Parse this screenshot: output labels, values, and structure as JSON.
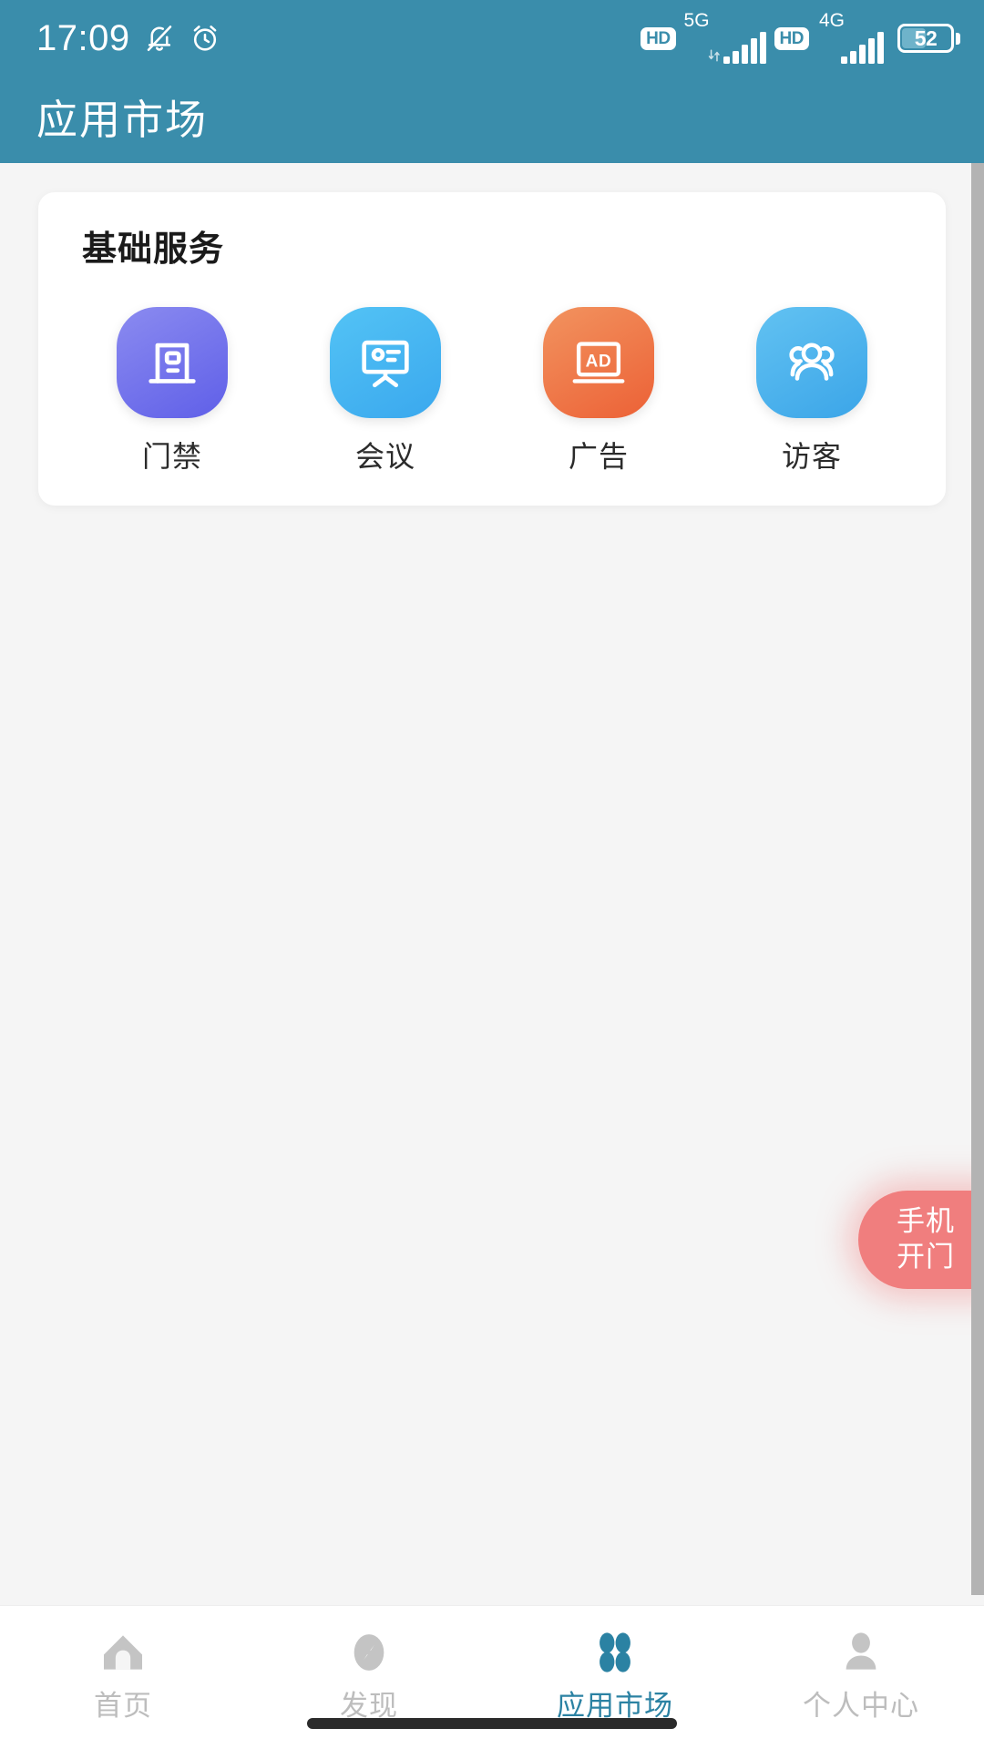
{
  "status_bar": {
    "time": "17:09",
    "mute_icon": "bell-muted-icon",
    "alarm_icon": "alarm-clock-icon",
    "sim1": {
      "hd_label": "HD",
      "network": "5G",
      "signal_bars": 5
    },
    "sim2": {
      "hd_label": "HD",
      "network": "4G",
      "signal_bars": 5
    },
    "battery": {
      "percent": "52",
      "level": 52
    }
  },
  "app_bar": {
    "title": "应用市场"
  },
  "card": {
    "title": "基础服务",
    "items": [
      {
        "label": "门禁",
        "icon": "door-access-icon",
        "color_start": "#8b8bf0",
        "color_end": "#5f5fe8"
      },
      {
        "label": "会议",
        "icon": "presentation-board-icon",
        "color_start": "#53c3f5",
        "color_end": "#3aa8ee"
      },
      {
        "label": "广告",
        "icon": "ad-screen-icon",
        "color_start": "#f2935f",
        "color_end": "#ec6136"
      },
      {
        "label": "访客",
        "icon": "visitors-group-icon",
        "color_start": "#62c2f2",
        "color_end": "#3ba5e8"
      }
    ]
  },
  "floating_button": {
    "line1": "手机",
    "line2": "开门",
    "color": "#f07e7e"
  },
  "bottom_nav": {
    "active_color": "#2b82a3",
    "inactive_color": "#bdbdbd",
    "items": [
      {
        "label": "首页",
        "icon": "home-icon",
        "active": false
      },
      {
        "label": "发现",
        "icon": "compass-icon",
        "active": false
      },
      {
        "label": "应用市场",
        "icon": "apps-grid-icon",
        "active": true
      },
      {
        "label": "个人中心",
        "icon": "person-icon",
        "active": false
      }
    ]
  },
  "theme": {
    "header_color": "#3a8dab",
    "background": "#f5f5f5",
    "card_background": "#ffffff",
    "scrollbar_color": "#b3b3b3"
  }
}
